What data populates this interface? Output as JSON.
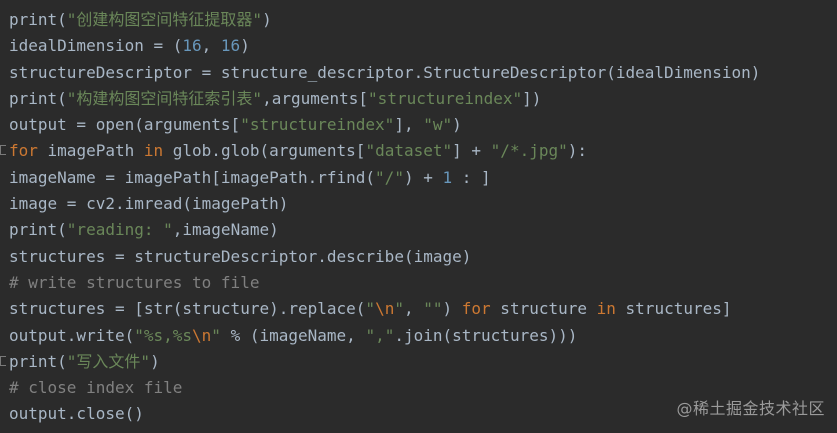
{
  "editor": {
    "lines": [
      {
        "parts": [
          {
            "t": "print(",
            "c": "fn"
          },
          {
            "t": "\"创建构图空间特征提取器\"",
            "c": "str"
          },
          {
            "t": ")",
            "c": "fn"
          }
        ]
      },
      {
        "parts": [
          {
            "t": "idealDimension = (",
            "c": "fn"
          },
          {
            "t": "16",
            "c": "num"
          },
          {
            "t": ", ",
            "c": "fn"
          },
          {
            "t": "16",
            "c": "num"
          },
          {
            "t": ")",
            "c": "fn"
          }
        ]
      },
      {
        "parts": [
          {
            "t": "structureDescriptor = structure_descriptor.StructureDescriptor(idealDimension)",
            "c": "fn"
          }
        ]
      },
      {
        "parts": [
          {
            "t": "print(",
            "c": "fn"
          },
          {
            "t": "\"构建构图空间特征索引表\"",
            "c": "str"
          },
          {
            "t": ",arguments[",
            "c": "fn"
          },
          {
            "t": "\"structureindex\"",
            "c": "str"
          },
          {
            "t": "])",
            "c": "fn"
          }
        ]
      },
      {
        "parts": [
          {
            "t": "output = open(arguments[",
            "c": "fn"
          },
          {
            "t": "\"structureindex\"",
            "c": "str"
          },
          {
            "t": "], ",
            "c": "fn"
          },
          {
            "t": "\"w\"",
            "c": "str"
          },
          {
            "t": ")",
            "c": "fn"
          }
        ]
      },
      {
        "parts": [
          {
            "t": "for",
            "c": "kw"
          },
          {
            "t": " imagePath ",
            "c": "fn"
          },
          {
            "t": "in",
            "c": "kw"
          },
          {
            "t": " glob.glob(arguments[",
            "c": "fn"
          },
          {
            "t": "\"dataset\"",
            "c": "str"
          },
          {
            "t": "] + ",
            "c": "fn"
          },
          {
            "t": "\"/*.jpg\"",
            "c": "str"
          },
          {
            "t": "):",
            "c": "fn"
          }
        ],
        "marker": true
      },
      {
        "indent": true,
        "parts": [
          {
            "t": "imageName = imagePath[imagePath.rfind(",
            "c": "fn"
          },
          {
            "t": "\"/\"",
            "c": "str"
          },
          {
            "t": ") + ",
            "c": "fn"
          },
          {
            "t": "1",
            "c": "num"
          },
          {
            "t": " : ]",
            "c": "fn"
          }
        ]
      },
      {
        "indent": true,
        "parts": [
          {
            "t": "image = cv2.imread(imagePath)",
            "c": "fn"
          }
        ]
      },
      {
        "indent": true,
        "parts": [
          {
            "t": "print(",
            "c": "fn"
          },
          {
            "t": "\"reading: \"",
            "c": "str"
          },
          {
            "t": ",imageName)",
            "c": "fn"
          }
        ]
      },
      {
        "indent": true,
        "parts": [
          {
            "t": "structures = structureDescriptor.describe(image)",
            "c": "fn"
          }
        ]
      },
      {
        "indent": true,
        "parts": [
          {
            "t": "# write structures to file",
            "c": "cmt"
          }
        ]
      },
      {
        "indent": true,
        "parts": [
          {
            "t": "structures = [str(structure).replace(",
            "c": "fn"
          },
          {
            "t": "\"",
            "c": "str"
          },
          {
            "t": "\\n",
            "c": "esc"
          },
          {
            "t": "\"",
            "c": "str"
          },
          {
            "t": ", ",
            "c": "fn"
          },
          {
            "t": "\"\"",
            "c": "str"
          },
          {
            "t": ") ",
            "c": "fn"
          },
          {
            "t": "for",
            "c": "kw"
          },
          {
            "t": " structure ",
            "c": "fn"
          },
          {
            "t": "in",
            "c": "kw"
          },
          {
            "t": " structures]",
            "c": "fn"
          }
        ]
      },
      {
        "indent": true,
        "parts": [
          {
            "t": "output.write(",
            "c": "fn"
          },
          {
            "t": "\"%s,%s",
            "c": "str"
          },
          {
            "t": "\\n",
            "c": "esc"
          },
          {
            "t": "\"",
            "c": "str"
          },
          {
            "t": " % (imageName, ",
            "c": "fn"
          },
          {
            "t": "\",\"",
            "c": "str"
          },
          {
            "t": ".join(structures)))",
            "c": "fn"
          }
        ]
      },
      {
        "indent": true,
        "parts": [
          {
            "t": "print(",
            "c": "fn"
          },
          {
            "t": "\"写入文件\"",
            "c": "str"
          },
          {
            "t": ")",
            "c": "fn"
          }
        ],
        "marker": true
      },
      {
        "parts": [
          {
            "t": "# close index file",
            "c": "cmt"
          }
        ]
      },
      {
        "parts": [
          {
            "t": "output.close()",
            "c": "fn"
          }
        ]
      }
    ]
  },
  "watermark": {
    "text": "@稀土掘金技术社区"
  },
  "colors": {
    "background": "#2b2b2b",
    "default_text": "#a9b7c6",
    "keyword": "#cc7832",
    "string": "#6a8759",
    "number": "#6897bb",
    "comment": "#808080"
  }
}
